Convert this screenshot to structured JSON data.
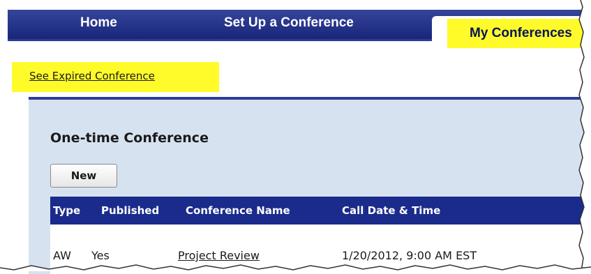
{
  "nav": {
    "tabs": [
      {
        "label": "Home"
      },
      {
        "label": "Set Up a Conference"
      },
      {
        "label": "My Conferences",
        "active": true
      }
    ]
  },
  "links": {
    "expired": "See Expired Conference"
  },
  "section": {
    "title": "One-time Conference",
    "new_button": "New"
  },
  "table": {
    "headers": [
      "Type",
      "Published",
      "Conference Name",
      "Call Date & Time"
    ],
    "rows": [
      {
        "type": "AW",
        "published": "Yes",
        "name": "Project Review",
        "datetime": "1/20/2012, 9:00 AM EST"
      }
    ]
  },
  "colors": {
    "nav_bg": "#1f2e85",
    "highlight": "#fffb2a",
    "panel_bg": "#d7e2f1",
    "header_bg": "#1a2b8c"
  }
}
